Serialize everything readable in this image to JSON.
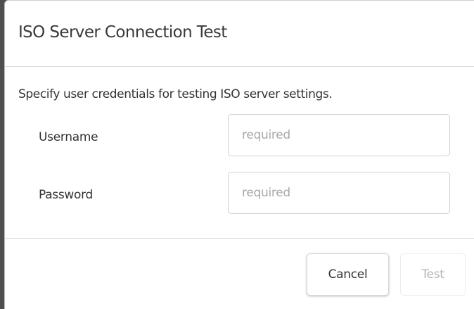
{
  "dialog": {
    "title": "ISO Server Connection Test",
    "description": "Specify user credentials for testing ISO server settings.",
    "fields": [
      {
        "label": "Username",
        "value": "",
        "placeholder": "required"
      },
      {
        "label": "Password",
        "value": "",
        "placeholder": "required"
      }
    ],
    "buttons": {
      "cancel_label": "Cancel",
      "test_label": "Test",
      "test_enabled": false
    }
  },
  "colors": {
    "backdrop": "#4f4f4f",
    "dialog_bg": "#ffffff",
    "text": "#333333",
    "placeholder": "#a8a8a8",
    "disabled_text": "#b5b5b5",
    "divider": "#dcdcdc"
  }
}
